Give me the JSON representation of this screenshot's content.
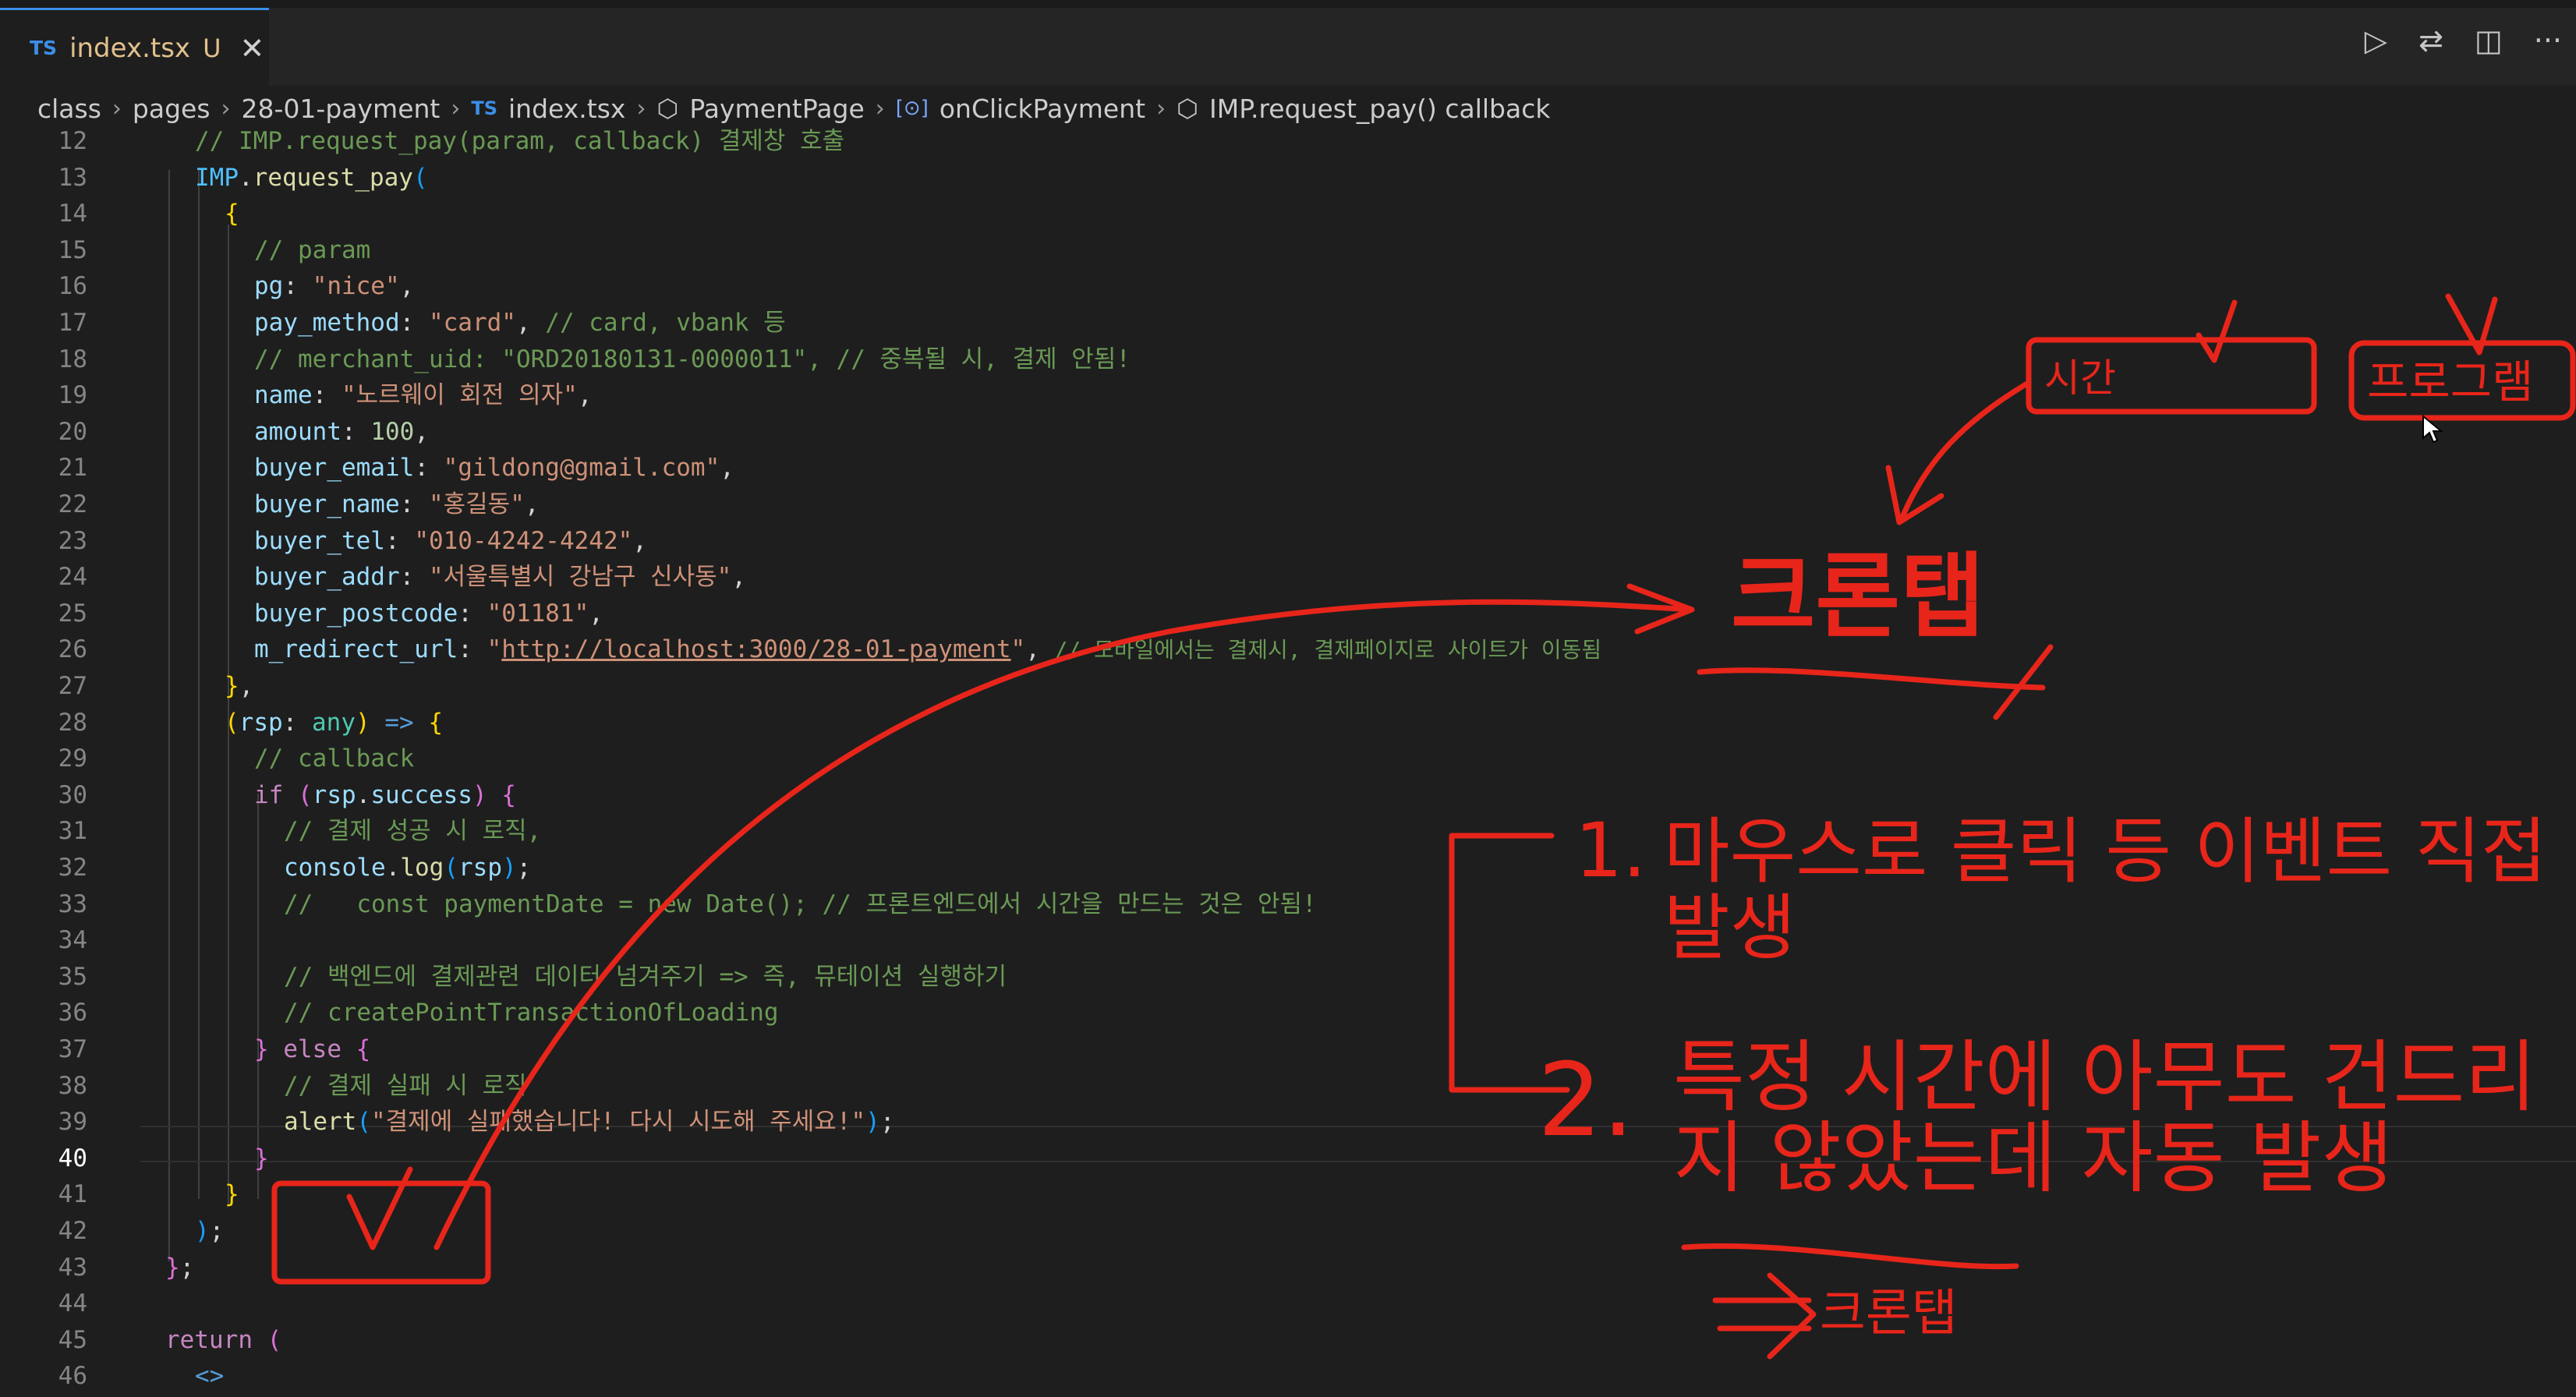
{
  "tab": {
    "lang_badge": "TS",
    "filename": "index.tsx",
    "status": "U",
    "close_glyph": "✕"
  },
  "actions": {
    "run_icon": "▷",
    "compare_icon": "⇄",
    "split_icon": "◫",
    "more_icon": "···"
  },
  "breadcrumb": {
    "items": [
      "class",
      "pages",
      "28-01-payment",
      "index.tsx",
      "PaymentPage",
      "onClickPayment",
      "IMP.request_pay() callback"
    ],
    "ts_badge": "TS",
    "cube_icon": "⬡",
    "var_icon": "[⊙]"
  },
  "editor": {
    "line_numbers": [
      "12",
      "13",
      "14",
      "15",
      "16",
      "17",
      "18",
      "19",
      "20",
      "21",
      "22",
      "23",
      "24",
      "25",
      "26",
      "27",
      "28",
      "29",
      "30",
      "31",
      "32",
      "33",
      "34",
      "35",
      "36",
      "37",
      "38",
      "39",
      "40",
      "41",
      "42",
      "43",
      "44",
      "45",
      "46"
    ],
    "active_line": "40",
    "t": {
      "l12": "// IMP.request_pay(param, callback) 결제창 호출",
      "l13_imp": "IMP",
      "l13_dot": ".",
      "l13_fn": "request_pay",
      "l13_p": "(",
      "l14": "{",
      "l15": "// param",
      "l16_k": "pg",
      "l16_c": ": ",
      "l16_v": "\"nice\"",
      "l16_e": ",",
      "l17_k": "pay_method",
      "l17_c": ": ",
      "l17_v": "\"card\"",
      "l17_e": ", ",
      "l17_cm": "// card, vbank 등",
      "l18": "// merchant_uid: \"ORD20180131-0000011\", // 중복될 시, 결제 안됨!",
      "l19_k": "name",
      "l19_c": ": ",
      "l19_v": "\"노르웨이 회전 의자\"",
      "l19_e": ",",
      "l20_k": "amount",
      "l20_c": ": ",
      "l20_v": "100",
      "l20_e": ",",
      "l21_k": "buyer_email",
      "l21_c": ": ",
      "l21_v": "\"gildong@gmail.com\"",
      "l21_e": ",",
      "l22_k": "buyer_name",
      "l22_c": ": ",
      "l22_v": "\"홍길동\"",
      "l22_e": ",",
      "l23_k": "buyer_tel",
      "l23_c": ": ",
      "l23_v": "\"010-4242-4242\"",
      "l23_e": ",",
      "l24_k": "buyer_addr",
      "l24_c": ": ",
      "l24_v": "\"서울특별시 강남구 신사동\"",
      "l24_e": ",",
      "l25_k": "buyer_postcode",
      "l25_c": ": ",
      "l25_v": "\"01181\"",
      "l25_e": ",",
      "l26_k": "m_redirect_url",
      "l26_c": ": ",
      "l26_q1": "\"",
      "l26_url": "http://localhost:3000/28-01-payment",
      "l26_q2": "\"",
      "l26_e": ", ",
      "l26_cm": "// 모바일에서는 결제시, 결제페이지로 사이트가 이동됨",
      "l27_b": "}",
      "l27_e": ",",
      "l28_p": "(",
      "l28_k": "rsp",
      "l28_c": ": ",
      "l28_ty": "any",
      "l28_p2": ") ",
      "l28_ar": "=>",
      "l28_b": " {",
      "l29": "// callback",
      "l30_if": "if",
      "l30_p": " (",
      "l30_v": "rsp",
      "l30_dot": ".",
      "l30_k": "success",
      "l30_p2": ") {",
      "l31": "// 결제 성공 시 로직,",
      "l32_v": "console",
      "l32_dot": ".",
      "l32_fn": "log",
      "l32_p": "(",
      "l32_k": "rsp",
      "l32_p2": ")",
      "l32_e": ";",
      "l33": "//   const paymentDate = new Date(); // 프론트엔드에서 시간을 만드는 것은 안됨!",
      "l35": "// 백엔드에 결제관련 데이터 넘겨주기 => 즉, 뮤테이션 실행하기",
      "l36": "// createPointTransactionOfLoading",
      "l37_b": "} ",
      "l37_else": "else",
      "l37_b2": " {",
      "l38": "// 결제 실패 시 로직",
      "l39_fn": "alert",
      "l39_p": "(",
      "l39_v": "\"결제에 실패했습니다! 다시 시도해 주세요!\"",
      "l39_p2": ")",
      "l39_e": ";",
      "l40": "}",
      "l41": "}",
      "l42_p": ")",
      "l42_e": ";",
      "l43_b": "}",
      "l43_e": ";",
      "l45_kw": "return",
      "l45_p": " (",
      "l46": "<>"
    }
  },
  "annotations": {
    "box_time": "시간",
    "box_program": "프로그램",
    "cron_big": "크론탭",
    "item1_num": "1.",
    "item1_line1": "마우스로 클릭 등 이벤트 직접",
    "item1_line2": "발생",
    "item2_num": "2.",
    "item2_line1": "특정 시간에 아무도 건드리",
    "item2_line2": "지 않았는데 자동 발생",
    "cron_small": "크론탭",
    "ink_color": "#e8251a"
  }
}
